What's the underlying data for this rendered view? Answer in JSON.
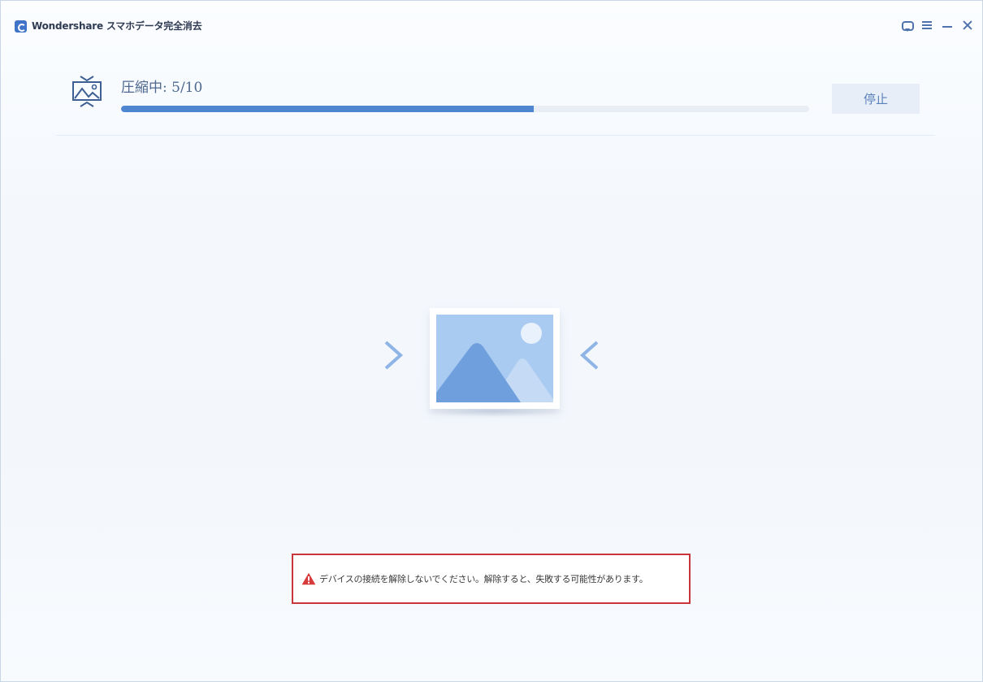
{
  "app": {
    "title": "Wondershare スマホデータ完全消去"
  },
  "title_controls": {
    "icons": [
      "feedback-icon",
      "menu-icon",
      "minimize-icon",
      "close-icon"
    ]
  },
  "progress": {
    "label": "圧縮中: 5/10",
    "fraction": 0.6,
    "stop_label": "停止"
  },
  "illustration": {
    "icon": "photo-compress-illustration"
  },
  "warning": {
    "text": "デバイスの接続を解除しないでください。解除すると、失敗する可能性があります。",
    "icon": "warning-triangle-icon"
  },
  "colors": {
    "accent": "#4e87cf",
    "warning": "#d83b3b",
    "warning_border": "#c8353a"
  }
}
